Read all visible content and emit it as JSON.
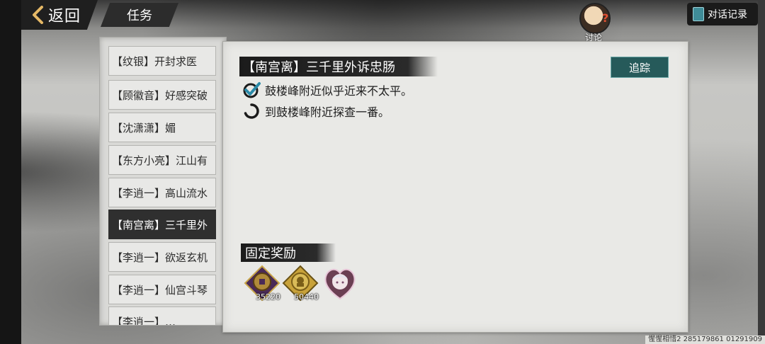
{
  "header": {
    "back_label": "返回",
    "title": "任务",
    "discuss_label": "讨论",
    "dialog_log_label": "对话记录"
  },
  "quest_list": [
    {
      "label": "【纹银】开封求医",
      "active": false
    },
    {
      "label": "【顾徽音】好感突破",
      "active": false
    },
    {
      "label": "【沈潇潇】媚",
      "active": false
    },
    {
      "label": "【东方小亮】江山有",
      "active": false
    },
    {
      "label": "【李逍一】高山流水",
      "active": false
    },
    {
      "label": "【南宫离】三千里外",
      "active": true
    },
    {
      "label": "【李逍一】欲返玄机",
      "active": false
    },
    {
      "label": "【李逍一】仙宫斗琴",
      "active": false
    },
    {
      "label": "【李逍一】…",
      "active": false
    }
  ],
  "detail": {
    "title": "【南宫离】三千里外诉忠肠",
    "track_label": "追踪",
    "objectives": [
      {
        "text": "鼓楼峰附近似乎近来不太平。",
        "done": true
      },
      {
        "text": "到鼓楼峰附近探查一番。",
        "done": false
      }
    ],
    "reward_header": "固定奖励",
    "rewards": [
      {
        "icon": "coin-icon",
        "amount": "35220"
      },
      {
        "icon": "gold-medal-icon",
        "amount": "50440"
      },
      {
        "icon": "heart-portrait-icon",
        "amount": ""
      }
    ]
  },
  "footer": {
    "text": "惺惺相惜2 285179861 01291909"
  },
  "colors": {
    "track_button": "#265a5a",
    "check": "#2a8aa8"
  }
}
